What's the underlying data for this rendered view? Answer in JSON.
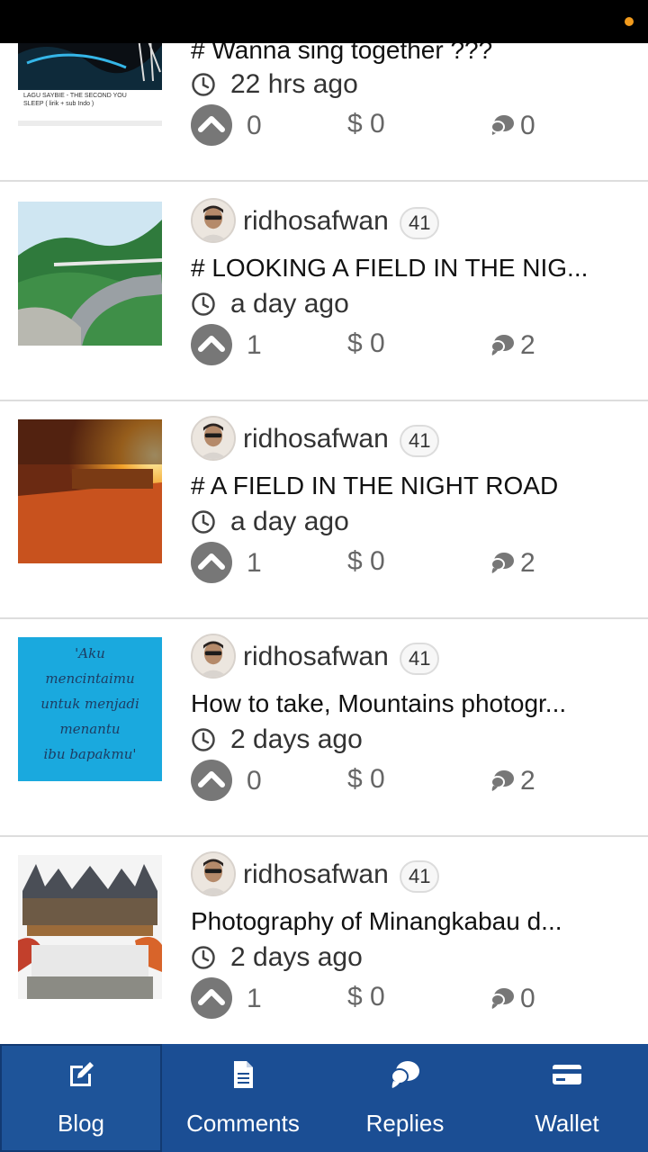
{
  "colors": {
    "accent": "#1b4e94",
    "status_dot": "#f29b1d",
    "icon_gray": "#777777",
    "divider": "#dddddd"
  },
  "posts": [
    {
      "thumb_text": [
        "LAGU SAYBIE - THE SECOND YOU",
        "SLEEP ( lirik + sub Indo )"
      ],
      "title": "# Wanna sing together ???",
      "time": "22 hrs ago",
      "votes": "0",
      "payout": "$ 0",
      "comments": "0"
    },
    {
      "author": "ridhosafwan",
      "reputation": "41",
      "title": "# LOOKING A FIELD IN THE NIG...",
      "time": "a day ago",
      "votes": "1",
      "payout": "$ 0",
      "comments": "2"
    },
    {
      "author": "ridhosafwan",
      "reputation": "41",
      "title": "# A FIELD IN THE NIGHT ROAD",
      "time": "a day ago",
      "votes": "1",
      "payout": "$ 0",
      "comments": "2"
    },
    {
      "author": "ridhosafwan",
      "reputation": "41",
      "thumb_text": [
        "'Aku",
        "mencintaimu",
        "untuk menjadi",
        "menantu",
        "ibu bapakmu'"
      ],
      "title": "How to take, Mountains photogr...",
      "time": "2 days ago",
      "votes": "0",
      "payout": "$ 0",
      "comments": "2"
    },
    {
      "author": "ridhosafwan",
      "reputation": "41",
      "title": "Photography of Minangkabau d...",
      "time": "2 days ago",
      "votes": "1",
      "payout": "$ 0",
      "comments": "0"
    }
  ],
  "tabs": [
    {
      "label": "Blog",
      "icon": "edit-icon",
      "active": true
    },
    {
      "label": "Comments",
      "icon": "document-icon"
    },
    {
      "label": "Replies",
      "icon": "chat-bubbles-icon"
    },
    {
      "label": "Wallet",
      "icon": "credit-card-icon"
    }
  ]
}
